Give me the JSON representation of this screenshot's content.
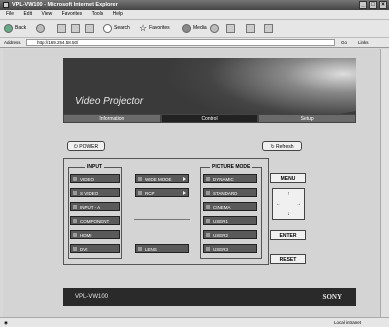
{
  "window": {
    "title": "VPL-VW100 - Microsoft Internet Explorer"
  },
  "menu": [
    "File",
    "Edit",
    "View",
    "Favorites",
    "Tools",
    "Help"
  ],
  "toolbar": {
    "back": "Back",
    "search": "Search",
    "favorites": "Favorites",
    "media": "Media"
  },
  "address": {
    "label": "Address",
    "url": "http://169.254.58.50/",
    "go": "Go",
    "links": "Links"
  },
  "header": {
    "brand": "Video Projector"
  },
  "nav": {
    "information": "Information",
    "control": "Control",
    "setup": "Setup"
  },
  "power_label": "POWER",
  "refresh_label": "Refresh",
  "input": {
    "title": "INPUT",
    "items": [
      "VIDEO",
      "S VIDEO",
      "INPUT - A",
      "COMPONENT",
      "HDMI",
      "DVI"
    ]
  },
  "wide_mode_label": "WIDE MODE",
  "rcp_label": "RCP",
  "lens_label": "LENS",
  "picture_mode": {
    "title": "PICTURE MODE",
    "items": [
      "DYNAMIC",
      "STANDARD",
      "CINEMA",
      "USER1",
      "USER2",
      "USER3"
    ]
  },
  "menu_label": "MENU",
  "enter_label": "ENTER",
  "reset_label": "RESET",
  "arrows": {
    "up": "↑",
    "left": "←",
    "right": "→",
    "down": "↓"
  },
  "footer": {
    "model": "VPL-VW100",
    "brand": "SONY"
  },
  "status": {
    "zone": "Local intranet"
  }
}
